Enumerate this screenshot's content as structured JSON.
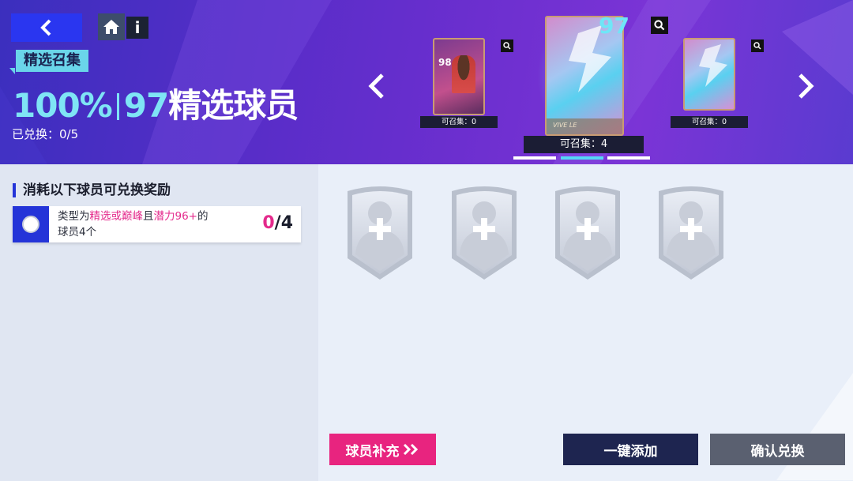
{
  "header": {
    "tag": "精选召集",
    "headline_percent": "100%",
    "headline_rating": "97",
    "headline_text": "精选球员",
    "redeemed_label": "已兑换：",
    "redeemed_value": "0/5"
  },
  "carousel": {
    "left_card": {
      "rating": "98",
      "count_label": "可召集：",
      "count": "0"
    },
    "center_card": {
      "rating": "97",
      "count_label": "可召集：",
      "count": "4",
      "brand_text": "VIVE LE"
    },
    "right_card": {
      "count_label": "可召集：",
      "count": "0"
    },
    "active_page": 2,
    "page_count": 3
  },
  "left_panel": {
    "section_title": "消耗以下球员可兑换奖励",
    "task": {
      "text_prefix": "类型为",
      "text_highlight1": "精选或巅峰",
      "text_mid": "且",
      "text_highlight2": "潜力96+",
      "text_suffix": "的",
      "text_line2": "球员4个",
      "progress_current": "0",
      "progress_total": "/4"
    }
  },
  "slots": [
    {
      "label": "empty-slot"
    },
    {
      "label": "empty-slot"
    },
    {
      "label": "empty-slot"
    },
    {
      "label": "empty-slot"
    }
  ],
  "buttons": {
    "supplement": "球员补充",
    "add_all": "一键添加",
    "confirm": "确认兑换"
  },
  "colors": {
    "accent_blue": "#2434d8",
    "pink": "#e42a8c",
    "cyan": "#7fe4f5",
    "dark_button": "#1e2550",
    "gray_button": "#5a6070"
  }
}
